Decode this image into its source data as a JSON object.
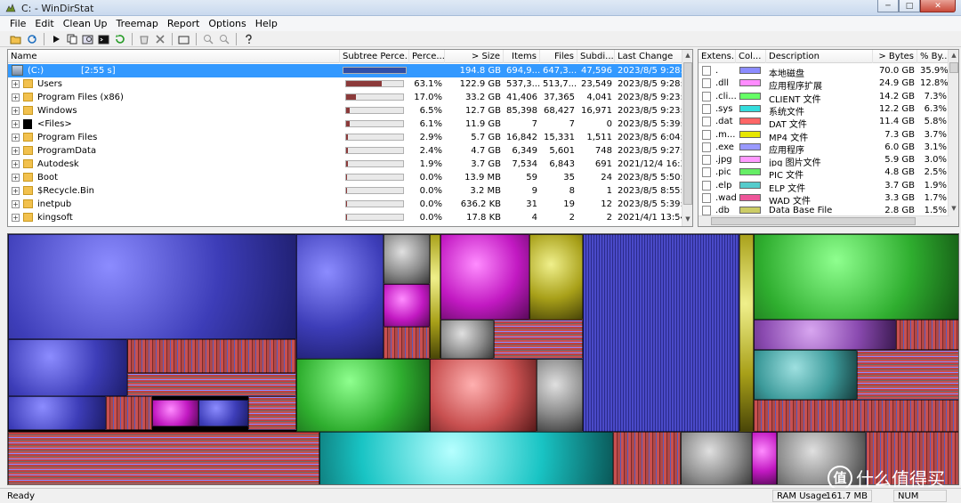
{
  "window": {
    "title": "C: - WinDirStat",
    "minimize": "─",
    "maximize": "□",
    "close": "✕"
  },
  "menu": [
    "File",
    "Edit",
    "Clean Up",
    "Treemap",
    "Report",
    "Options",
    "Help"
  ],
  "toolbar": [
    "open-icon",
    "refresh-all-icon",
    "play-icon",
    "copy-path-icon",
    "explorer-icon",
    "cmd-icon",
    "refresh-icon",
    "recycle-icon",
    "delete-icon",
    "new-folder-icon",
    "zoom-in-icon",
    "zoom-out-icon",
    "help-icon"
  ],
  "dir_columns": [
    "Name",
    "Subtree Perce...",
    "Perce...",
    "> Size",
    "Items",
    "Files",
    "Subdi...",
    "Last Change"
  ],
  "dir_rows": [
    {
      "name": "(C:)",
      "subtree": "[2:55 s]",
      "percent": "",
      "size": "194.8 GB",
      "items": "694,9...",
      "files": "647,3...",
      "subdirs": "47,596",
      "last_change": "2023/8/5  9:28:3",
      "bar": 1.0,
      "icon": "drive-icon",
      "expander": "",
      "selected": true
    },
    {
      "name": "Users",
      "subtree": "",
      "percent": "63.1%",
      "size": "122.9 GB",
      "items": "537,3...",
      "files": "513,7...",
      "subdirs": "23,549",
      "last_change": "2023/8/5  9:28:3",
      "bar": 0.631,
      "icon": "folder-icon",
      "expander": "+",
      "selected": false
    },
    {
      "name": "Program Files (x86)",
      "subtree": "",
      "percent": "17.0%",
      "size": "33.2 GB",
      "items": "41,406",
      "files": "37,365",
      "subdirs": "4,041",
      "last_change": "2023/8/5  9:23:0",
      "bar": 0.17,
      "icon": "folder-icon",
      "expander": "+",
      "selected": false
    },
    {
      "name": "Windows",
      "subtree": "",
      "percent": "6.5%",
      "size": "12.7 GB",
      "items": "85,398",
      "files": "68,427",
      "subdirs": "16,971",
      "last_change": "2023/8/5  9:23:2",
      "bar": 0.065,
      "icon": "folder-icon",
      "expander": "+",
      "selected": false
    },
    {
      "name": "<Files>",
      "subtree": "",
      "percent": "6.1%",
      "size": "11.9 GB",
      "items": "7",
      "files": "7",
      "subdirs": "0",
      "last_change": "2023/8/5  5:39:5",
      "bar": 0.061,
      "icon": "files-icon",
      "expander": "+",
      "selected": false
    },
    {
      "name": "Program Files",
      "subtree": "",
      "percent": "2.9%",
      "size": "5.7 GB",
      "items": "16,842",
      "files": "15,331",
      "subdirs": "1,511",
      "last_change": "2023/8/5  6:04:5",
      "bar": 0.029,
      "icon": "folder-icon",
      "expander": "+",
      "selected": false
    },
    {
      "name": "ProgramData",
      "subtree": "",
      "percent": "2.4%",
      "size": "4.7 GB",
      "items": "6,349",
      "files": "5,601",
      "subdirs": "748",
      "last_change": "2023/8/5  9:27:2",
      "bar": 0.024,
      "icon": "folder-icon",
      "expander": "+",
      "selected": false
    },
    {
      "name": "Autodesk",
      "subtree": "",
      "percent": "1.9%",
      "size": "3.7 GB",
      "items": "7,534",
      "files": "6,843",
      "subdirs": "691",
      "last_change": "2021/12/4  16:3",
      "bar": 0.019,
      "icon": "folder-icon",
      "expander": "+",
      "selected": false
    },
    {
      "name": "Boot",
      "subtree": "",
      "percent": "0.0%",
      "size": "13.9 MB",
      "items": "59",
      "files": "35",
      "subdirs": "24",
      "last_change": "2023/8/5  5:50:0",
      "bar": 0.0,
      "icon": "folder-icon",
      "expander": "+",
      "selected": false
    },
    {
      "name": "$Recycle.Bin",
      "subtree": "",
      "percent": "0.0%",
      "size": "3.2 MB",
      "items": "9",
      "files": "8",
      "subdirs": "1",
      "last_change": "2023/8/5  8:55:5",
      "bar": 0.0,
      "icon": "folder-icon",
      "expander": "+",
      "selected": false
    },
    {
      "name": "inetpub",
      "subtree": "",
      "percent": "0.0%",
      "size": "636.2 KB",
      "items": "31",
      "files": "19",
      "subdirs": "12",
      "last_change": "2023/8/5  5:39:5",
      "bar": 0.0,
      "icon": "folder-icon",
      "expander": "+",
      "selected": false
    },
    {
      "name": "kingsoft",
      "subtree": "",
      "percent": "0.0%",
      "size": "17.8 KB",
      "items": "4",
      "files": "2",
      "subdirs": "2",
      "last_change": "2021/4/1  13:54",
      "bar": 0.0,
      "icon": "folder-icon",
      "expander": "+",
      "selected": false
    }
  ],
  "ext_columns": [
    "Extens...",
    "Col...",
    "Description",
    "> Bytes",
    "% By..."
  ],
  "ext_rows": [
    {
      "ext": ".",
      "color": "#8c8cff",
      "desc": "本地磁盘",
      "bytes": "70.0 GB",
      "pct": "35.9%"
    },
    {
      "ext": ".dll",
      "color": "#ff8cff",
      "desc": "应用程序扩展",
      "bytes": "24.9 GB",
      "pct": "12.8%"
    },
    {
      "ext": ".cli...",
      "color": "#66ff66",
      "desc": "CLIENT 文件",
      "bytes": "14.2 GB",
      "pct": "7.3%"
    },
    {
      "ext": ".sys",
      "color": "#33dddd",
      "desc": "系统文件",
      "bytes": "12.2 GB",
      "pct": "6.3%"
    },
    {
      "ext": ".dat",
      "color": "#ff6666",
      "desc": "DAT 文件",
      "bytes": "11.4 GB",
      "pct": "5.8%"
    },
    {
      "ext": ".m...",
      "color": "#e6e600",
      "desc": "MP4 文件",
      "bytes": "7.3 GB",
      "pct": "3.7%"
    },
    {
      "ext": ".exe",
      "color": "#9999ff",
      "desc": "应用程序",
      "bytes": "6.0 GB",
      "pct": "3.1%"
    },
    {
      "ext": ".jpg",
      "color": "#ff99ff",
      "desc": "jpg 图片文件",
      "bytes": "5.9 GB",
      "pct": "3.0%"
    },
    {
      "ext": ".pic",
      "color": "#66ee66",
      "desc": "PIC 文件",
      "bytes": "4.8 GB",
      "pct": "2.5%"
    },
    {
      "ext": ".elp",
      "color": "#55cccc",
      "desc": "ELP 文件",
      "bytes": "3.7 GB",
      "pct": "1.9%"
    },
    {
      "ext": ".wad",
      "color": "#ee5599",
      "desc": "WAD 文件",
      "bytes": "3.3 GB",
      "pct": "1.7%"
    },
    {
      "ext": ".db",
      "color": "#cccc66",
      "desc": "Data Base File",
      "bytes": "2.8 GB",
      "pct": "1.5%"
    }
  ],
  "status": {
    "ready": "Ready",
    "ram_label": "RAM Usage:",
    "ram_value": "161.7 MB",
    "num": "NUM"
  },
  "watermark": {
    "badge": "值",
    "text": "什么值得买"
  }
}
